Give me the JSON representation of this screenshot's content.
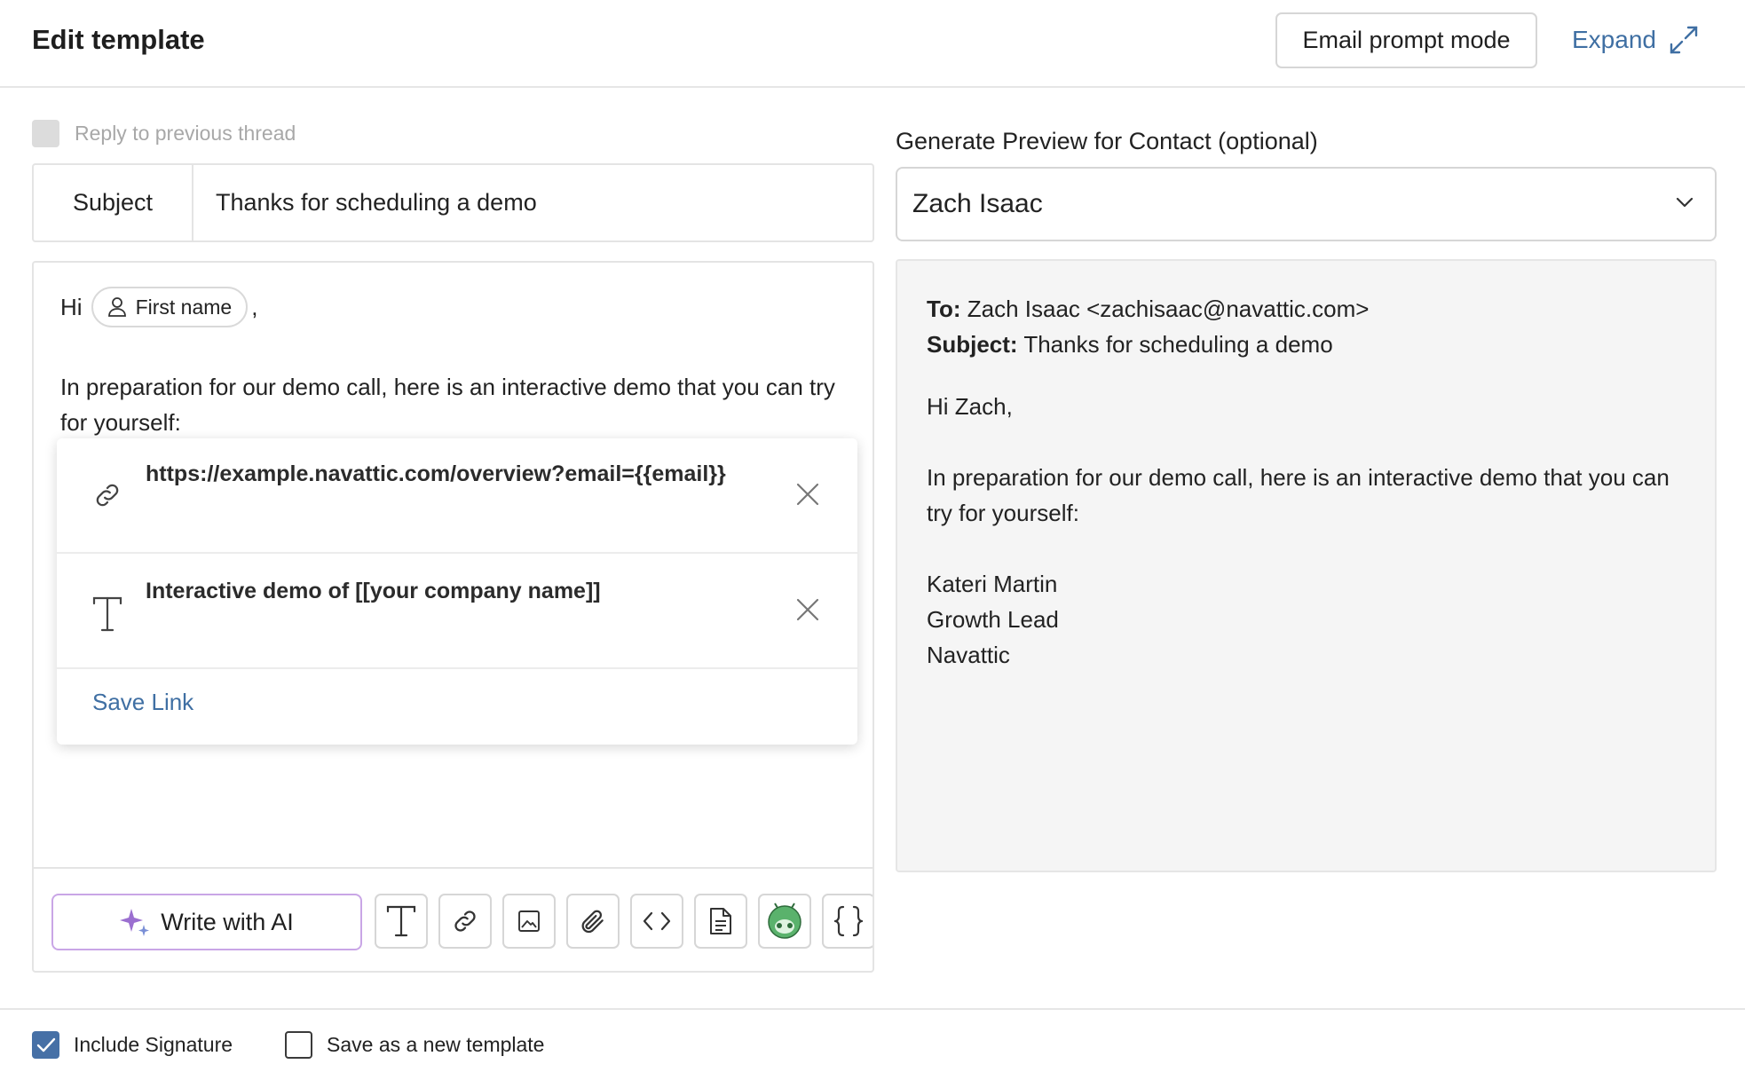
{
  "header": {
    "title": "Edit template",
    "prompt_mode_label": "Email prompt mode",
    "expand_label": "Expand"
  },
  "reply": {
    "label": "Reply to previous thread",
    "checked": false,
    "disabled": true
  },
  "subject": {
    "label": "Subject",
    "value": "Thanks for scheduling a demo"
  },
  "editor": {
    "greeting": "Hi",
    "variable_chip": "First name",
    "greeting_suffix": ",",
    "paragraph": "In preparation for our demo call, here is an interactive demo that you can try for yourself:"
  },
  "link_popover": {
    "url": "https://example.navattic.com/overview?email={{email}}",
    "text": "Interactive demo of [[your company name]]",
    "save_label": "Save Link"
  },
  "toolbar": {
    "ai_label": "Write with AI",
    "tools": [
      "text-format-icon",
      "link-icon",
      "image-icon",
      "attachment-icon",
      "code-icon",
      "document-icon",
      "bot-icon",
      "variables-icon"
    ],
    "ai_accent": "#9b6fd0"
  },
  "preview": {
    "label": "Generate Preview for Contact (optional)",
    "contact": "Zach Isaac",
    "to_label": "To:",
    "to_value": "Zach Isaac <zachisaac@navattic.com>",
    "subject_label": "Subject:",
    "subject_value": "Thanks for scheduling a demo",
    "greeting": "Hi Zach,",
    "paragraph": "In preparation for our demo call, here is an interactive demo that you can try for yourself:",
    "signature_name": "Kateri Martin",
    "signature_title": "Growth Lead",
    "signature_company": "Navattic"
  },
  "footer": {
    "include_signature_label": "Include Signature",
    "include_signature_checked": true,
    "save_new_label": "Save as a new template",
    "save_new_checked": false
  },
  "colors": {
    "link": "#3f6fa3",
    "checkbox": "#4670a6",
    "ai_border": "#c9a6e6"
  }
}
